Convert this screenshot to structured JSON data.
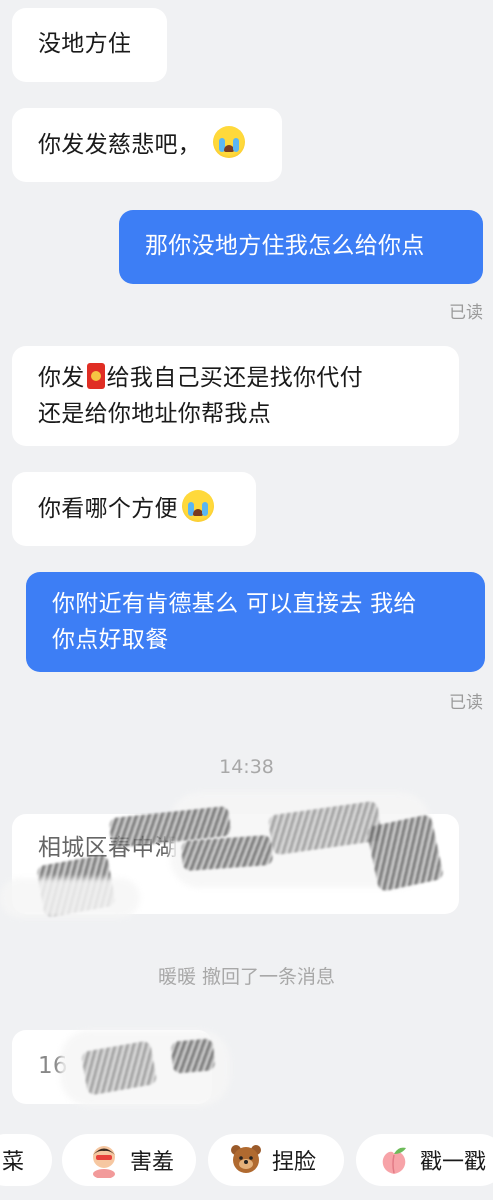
{
  "messages": [
    {
      "side": "left",
      "text": "没地方住"
    },
    {
      "side": "left",
      "text": "你发发慈悲吧，",
      "emoji": "loudly-crying-face"
    },
    {
      "side": "right",
      "text": "那你没地方住我怎么给你点",
      "status": "已读"
    },
    {
      "side": "left",
      "line1_a": "你发",
      "line1_icon": "red-packet",
      "line1_b": "给我自己买还是找你代付",
      "line2": "还是给你地址你帮我点"
    },
    {
      "side": "left",
      "text": "你看哪个方便",
      "emoji": "loudly-crying-face"
    },
    {
      "side": "right",
      "line1": "你附近有肯德基么 可以直接去 我给",
      "line2": "你点好取餐",
      "status": "已读"
    }
  ],
  "timestamp": "14:38",
  "redacted_address_prefix": "相城区春申湖",
  "recall_notice": {
    "name": "暖暖",
    "text": " 撤回了一条消息"
  },
  "redacted_number_prefix": "16",
  "quick_actions": [
    {
      "label": "菜",
      "icon": ""
    },
    {
      "label": "害羞",
      "icon": "shy-face"
    },
    {
      "label": "捏脸",
      "icon": "bear"
    },
    {
      "label": "戳一戳",
      "icon": "peach"
    }
  ]
}
